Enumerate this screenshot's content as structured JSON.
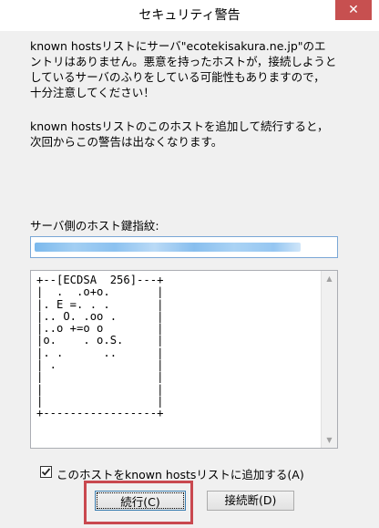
{
  "window": {
    "title": "セキュリティ警告",
    "close_glyph": "✕"
  },
  "messages": {
    "warning": "known hostsリストにサーバ\"ecotekisakura.ne.jp\"のエ\nントリはありません。悪意を持ったホストが，接続しようと\nしているサーバのふりをしている可能性もありますので，\n十分注意してください！",
    "info": "known hostsリストのこのホストを追加して続行すると，\n次回からこの警告は出なくなります。"
  },
  "fingerprint": {
    "label": "サーバ側のホスト鍵指紋:",
    "value": ""
  },
  "randomart": {
    "text": "+--[ECDSA  256]---+\n|  .  .o+o.       |\n|. E =. . .       |\n|.. O. .oo .      |\n|..o +=o o        |\n|o.    . o.S.     |\n|. .      ..      |\n| .               |\n|                 |\n|                 |\n|                 |\n+-----------------+"
  },
  "scrollbar": {
    "up_glyph": "▲",
    "down_glyph": "▼"
  },
  "add_to_known_hosts": {
    "label": "このホストをknown hostsリストに追加する(A)",
    "checked": true
  },
  "buttons": {
    "continue_label": "続行(C)",
    "disconnect_label": "接続断(D)"
  },
  "colors": {
    "close_button": "#c75050",
    "highlight": "#c9484f",
    "field_border": "#7aa7d6"
  }
}
